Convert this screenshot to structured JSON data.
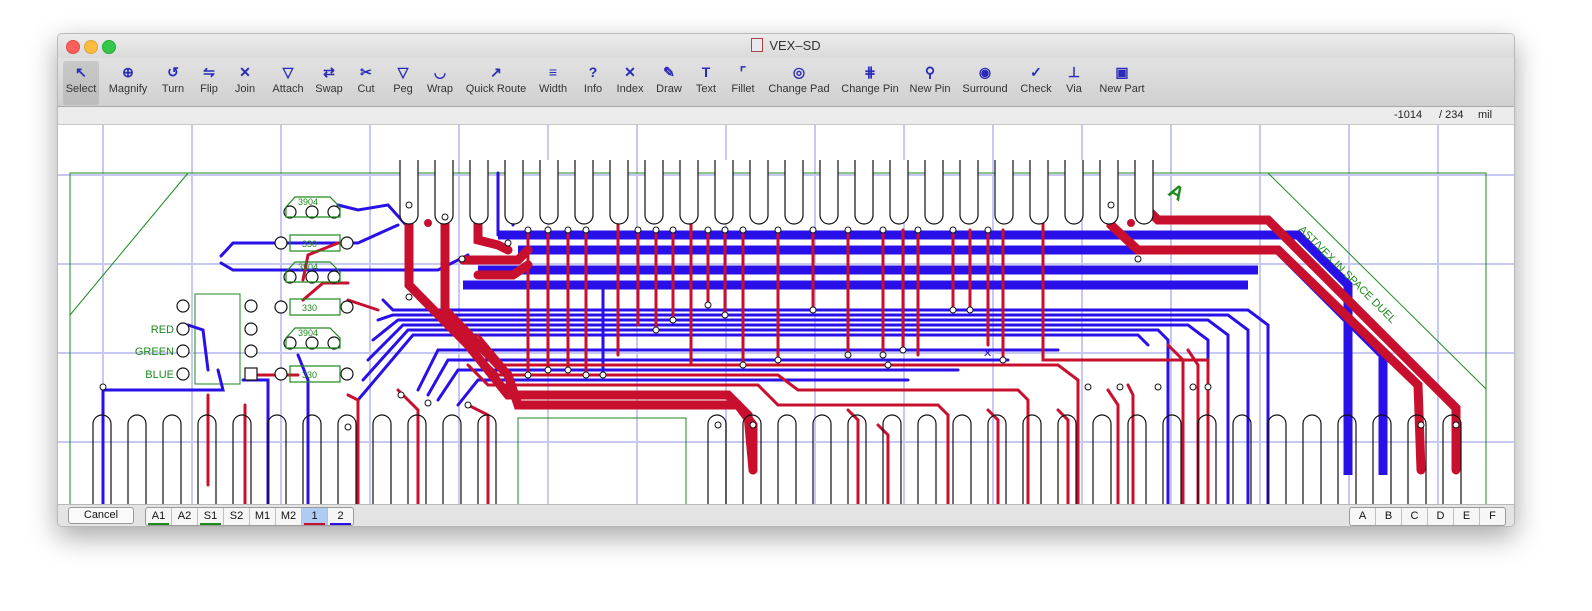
{
  "window": {
    "title": "VEX–SD"
  },
  "toolbar": {
    "tools": [
      {
        "label": "Select",
        "icon": "↖"
      },
      {
        "label": "Magnify",
        "icon": "⊕"
      },
      {
        "label": "Turn",
        "icon": "↺"
      },
      {
        "label": "Flip",
        "icon": "⇋"
      },
      {
        "label": "Join",
        "icon": "✕"
      },
      {
        "label": "Attach",
        "icon": "▽"
      },
      {
        "label": "Swap",
        "icon": "⇄"
      },
      {
        "label": "Cut",
        "icon": "✂"
      },
      {
        "label": "Peg",
        "icon": "▽"
      },
      {
        "label": "Wrap",
        "icon": "◡"
      },
      {
        "label": "Quick Route",
        "icon": "↗"
      },
      {
        "label": "Width",
        "icon": "≡"
      },
      {
        "label": "Info",
        "icon": "?"
      },
      {
        "label": "Index",
        "icon": "✕"
      },
      {
        "label": "Draw",
        "icon": "✎"
      },
      {
        "label": "Text",
        "icon": "T"
      },
      {
        "label": "Fillet",
        "icon": "⌜"
      },
      {
        "label": "Change Pad",
        "icon": "◎"
      },
      {
        "label": "Change Pin",
        "icon": "⋕"
      },
      {
        "label": "New Pin",
        "icon": "⚲"
      },
      {
        "label": "Surround",
        "icon": "◉"
      },
      {
        "label": "Check",
        "icon": "✓"
      },
      {
        "label": "Via",
        "icon": "⊥"
      },
      {
        "label": "New Part",
        "icon": "▣"
      }
    ]
  },
  "coords": {
    "x": "-1014",
    "y": "/ 234",
    "unit": "mil"
  },
  "board": {
    "labels": {
      "red": "RED",
      "green": "GREEN",
      "blue": "BLUE",
      "corner_letter": "A",
      "title_line": "AST/VEX IN SPACE DUEL"
    },
    "resistor_labels": [
      "3904",
      "330",
      "3904",
      "330",
      "3904",
      "330"
    ]
  },
  "bottom": {
    "cancel_label": "Cancel",
    "layers": [
      {
        "label": "A1",
        "underline": "#1e8a1e",
        "selected": false
      },
      {
        "label": "A2",
        "underline": "",
        "selected": false
      },
      {
        "label": "S1",
        "underline": "#1e8a1e",
        "selected": false
      },
      {
        "label": "S2",
        "underline": "",
        "selected": false
      },
      {
        "label": "M1",
        "underline": "",
        "selected": false
      },
      {
        "label": "M2",
        "underline": "",
        "selected": false
      },
      {
        "label": "1",
        "underline": "#c8102e",
        "selected": true
      },
      {
        "label": "2",
        "underline": "#2a10e8",
        "selected": false
      }
    ],
    "grids": [
      "A",
      "B",
      "C",
      "D",
      "E",
      "F"
    ]
  },
  "colors": {
    "top_copper": "#c8102e",
    "bottom_copper": "#2a10e8",
    "silk": "#1e8a1e",
    "grid": "#c8c8f4"
  }
}
